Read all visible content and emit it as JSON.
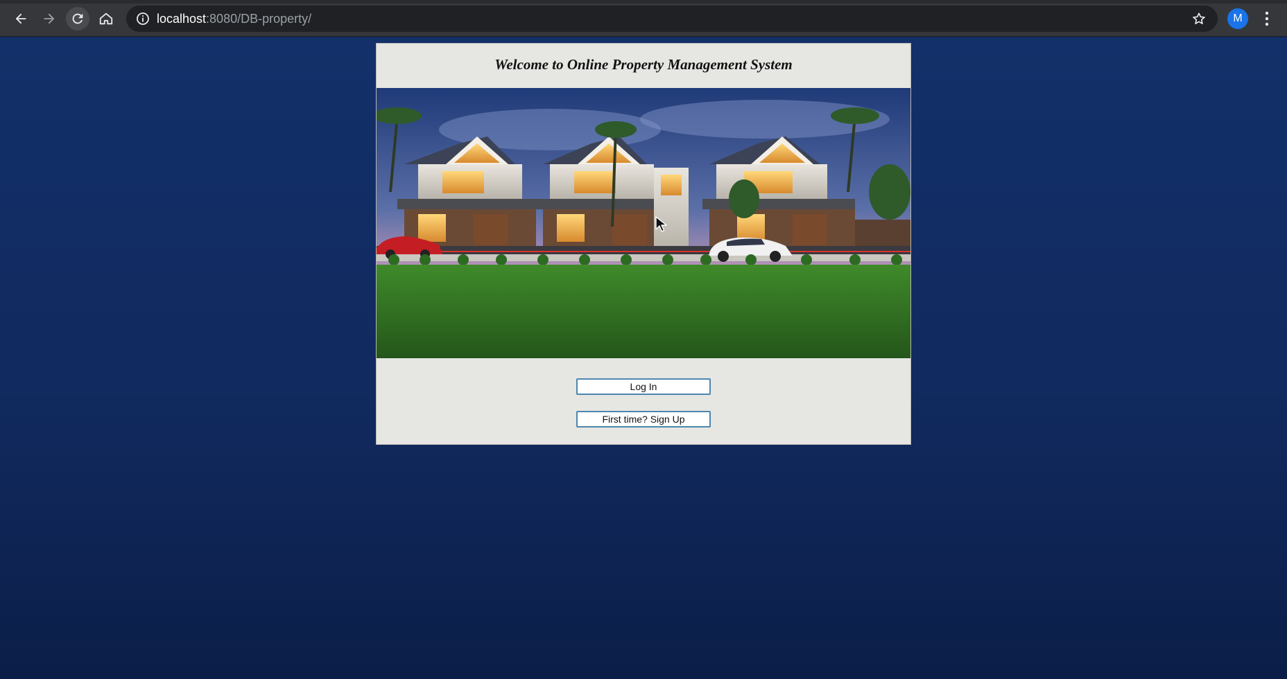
{
  "browser": {
    "url_host": "localhost",
    "url_path": ":8080/DB-property/",
    "profile_initial": "M",
    "icons": {
      "back": "arrow-left-icon",
      "forward": "arrow-right-icon",
      "reload": "reload-icon",
      "home": "home-icon",
      "site_info": "info-icon",
      "bookmark": "star-icon",
      "menu": "kebab-menu-icon"
    }
  },
  "page": {
    "title": "Welcome to Online Property Management System",
    "hero_image": "Modern luxury villas at dusk with palm trees, parked cars and a lawn",
    "buttons": {
      "login": "Log In",
      "signup": "First time? Sign Up"
    }
  },
  "colors": {
    "background": "#112a5f",
    "panel": "#e6e6e3",
    "button_border": "#4d86ad"
  }
}
